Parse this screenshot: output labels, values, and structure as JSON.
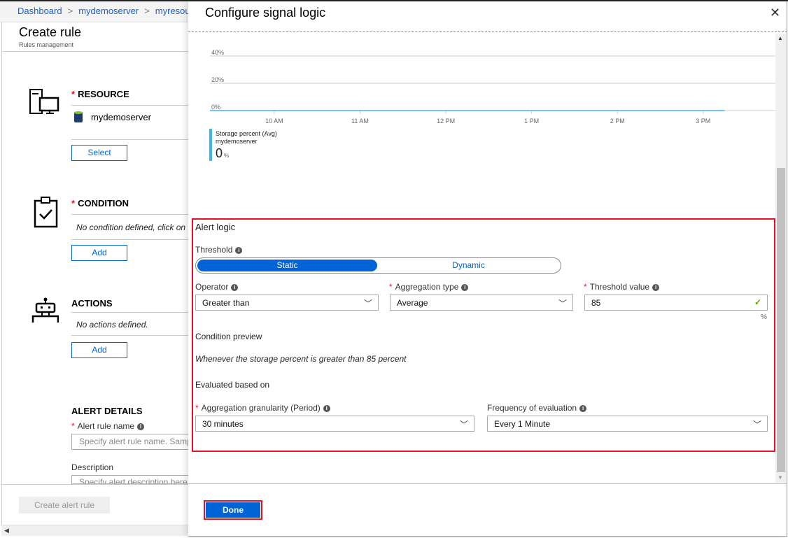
{
  "breadcrumb": [
    "Dashboard",
    "mydemoserver",
    "myresource"
  ],
  "left_blade": {
    "title": "Create rule",
    "subtitle": "Rules management",
    "resource": {
      "title": "RESOURCE",
      "name": "mydemoserver",
      "button": "Select"
    },
    "condition": {
      "title": "CONDITION",
      "text": "No condition defined, click on 'Add' to select a condition",
      "button": "Add"
    },
    "actions": {
      "title": "ACTIONS",
      "text": "No actions defined.",
      "button": "Add"
    },
    "alert_details": {
      "title": "ALERT DETAILS",
      "rule_name_label": "Alert rule name",
      "rule_name_placeholder": "Specify alert rule name. Sample",
      "description_label": "Description",
      "description_placeholder": "Specify alert description here"
    },
    "create_button": "Create alert rule"
  },
  "panel": {
    "title": "Configure signal logic",
    "legend": {
      "metric": "Storage percent (Avg)",
      "resource": "mydemoserver",
      "value": "0",
      "unit": "%"
    },
    "alert_logic": {
      "heading": "Alert logic",
      "threshold_label": "Threshold",
      "threshold_options": [
        "Static",
        "Dynamic"
      ],
      "threshold_selected": "Static",
      "operator_label": "Operator",
      "operator_value": "Greater than",
      "aggregation_label": "Aggregation type",
      "aggregation_value": "Average",
      "threshold_value_label": "Threshold value",
      "threshold_value": "85",
      "threshold_unit": "%",
      "preview_label": "Condition preview",
      "preview_text": "Whenever the storage percent is greater than 85 percent",
      "evaluated_label": "Evaluated based on",
      "granularity_label": "Aggregation granularity (Period)",
      "granularity_value": "30 minutes",
      "frequency_label": "Frequency of evaluation",
      "frequency_value": "Every 1 Minute"
    },
    "done_button": "Done"
  },
  "colors": {
    "accent": "#0063d6",
    "highlight": "#e81123",
    "series": "#3fb6ea",
    "valid": "#57a300"
  },
  "chart_data": {
    "type": "line",
    "x_ticks": [
      "10 AM",
      "11 AM",
      "12 PM",
      "1 PM",
      "2 PM",
      "3 PM"
    ],
    "y_ticks": [
      "0%",
      "20%",
      "40%"
    ],
    "ylim": [
      0,
      40
    ],
    "grid": true,
    "series": [
      {
        "name": "Storage percent (Avg)",
        "x": [
          "9:15 AM",
          "3:15 PM"
        ],
        "values": [
          0,
          0
        ]
      }
    ]
  }
}
